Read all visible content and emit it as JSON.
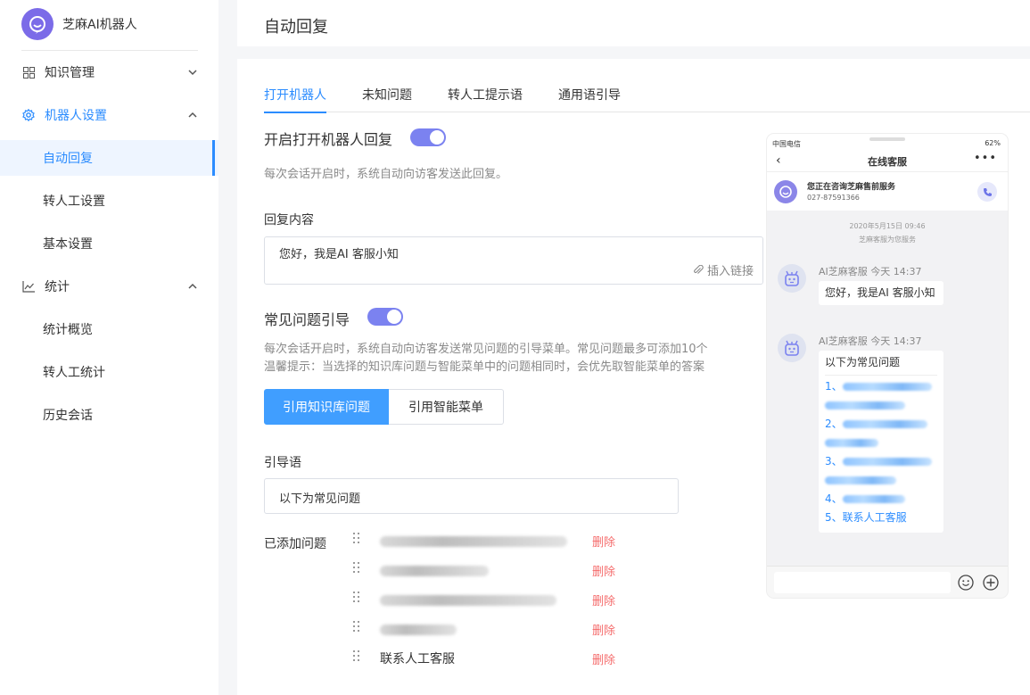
{
  "brand": {
    "name": "芝麻AI机器人"
  },
  "sidebar": {
    "groups": [
      {
        "label": "知识管理"
      },
      {
        "label": "机器人设置",
        "children": [
          "自动回复",
          "转人工设置",
          "基本设置"
        ]
      },
      {
        "label": "统计",
        "children": [
          "统计概览",
          "转人工统计",
          "历史会话"
        ]
      }
    ]
  },
  "header": {
    "title": "自动回复"
  },
  "tabs": [
    "打开机器人",
    "未知问题",
    "转人工提示语",
    "通用语引导"
  ],
  "robot": {
    "title": "开启打开机器人回复",
    "hint": "每次会话开启时，系统自动向访客发送此回复。",
    "reply_label": "回复内容",
    "reply_value": "您好，我是AI 客服小知",
    "insert_link": "插入链接"
  },
  "faq": {
    "title": "常见问题引导",
    "hint1": "每次会话开启时，系统自动向访客发送常见问题的引导菜单。常见问题最多可添加10个",
    "hint2": "温馨提示：当选择的知识库问题与智能菜单中的问题相同时，会优先取智能菜单的答案",
    "seg_a": "引用知识库问题",
    "seg_b": "引用智能菜单",
    "guide_label": "引导语",
    "guide_value": "以下为常见问题",
    "added_label": "已添加问题",
    "delete": "删除",
    "last_question": "联系人工客服"
  },
  "phone": {
    "carrier": "中国电信",
    "battery": "62%",
    "title": "在线客服",
    "company": "您正在咨询芝麻售前服务",
    "tel": "027-87591366",
    "time": "2020年5月15日 09:46",
    "sub": "芝麻客服为您服务",
    "bot_name": "AI芝麻客服 今天 14:37",
    "bubble1": "您好，我是AI 客服小知",
    "bubble2_title": "以下为常见问题",
    "q_prefix": [
      "1、",
      "2、",
      "3、",
      "4、"
    ],
    "q5": "5、联系人工客服"
  },
  "colors": {
    "accent": "#2b8cff",
    "toggle": "#7b82f0",
    "danger": "#f56c6c",
    "brand": "#7b6be8"
  }
}
